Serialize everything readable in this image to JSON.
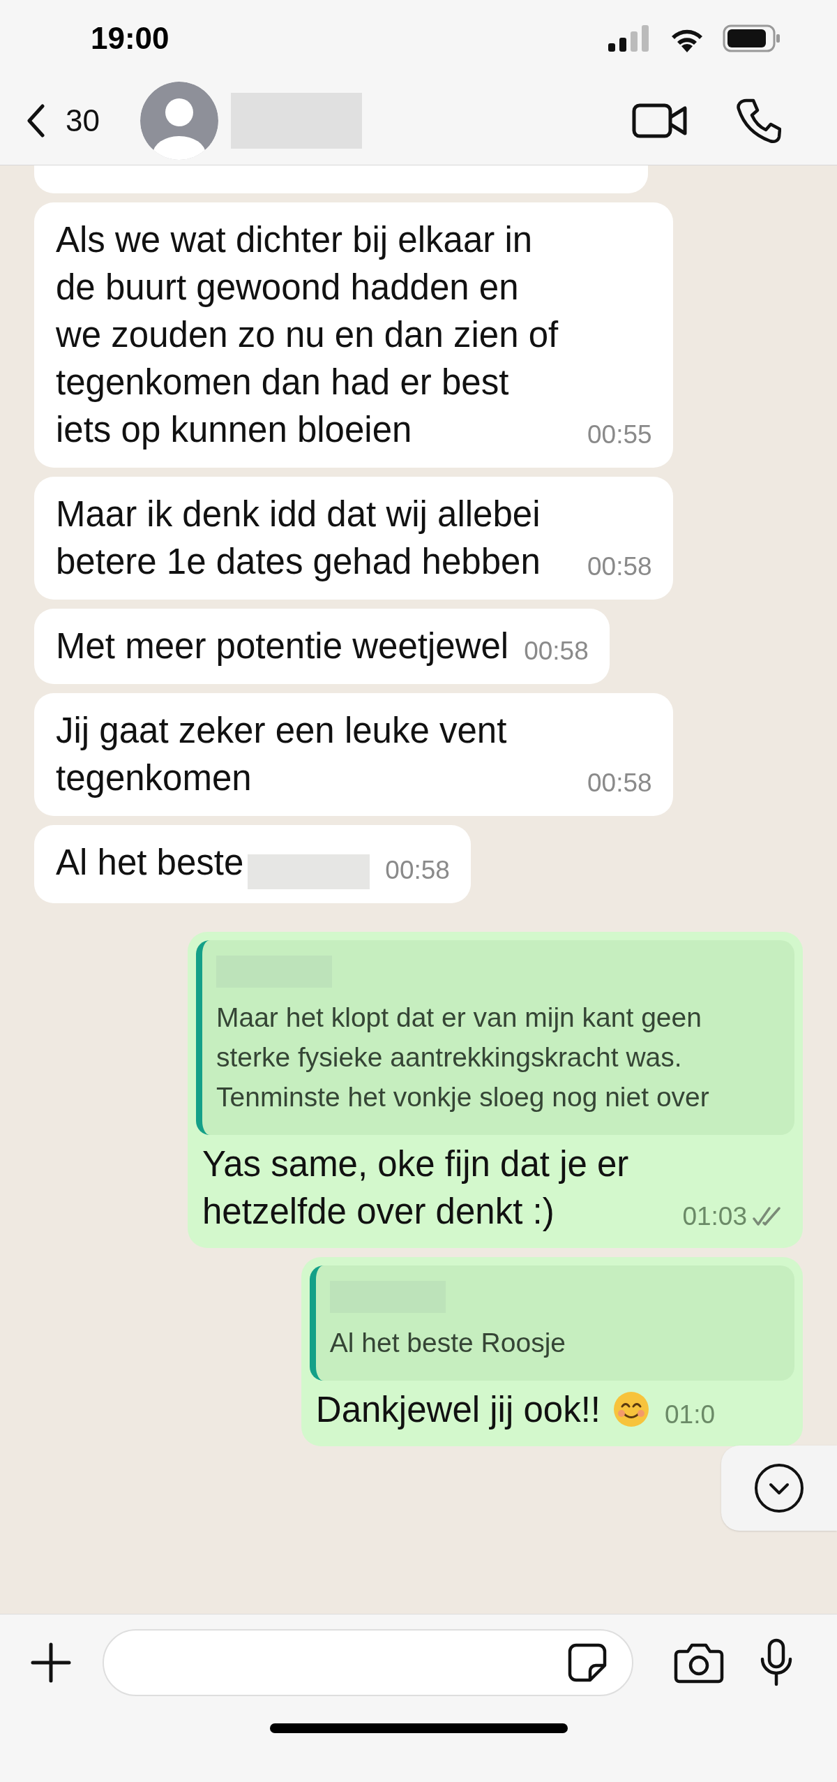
{
  "status_bar": {
    "time": "19:00"
  },
  "header": {
    "back_count": "30"
  },
  "messages": [
    {
      "outgoing": false,
      "text": "Als we wat dichter bij elkaar in de buurt gewoond hadden en we zouden zo nu en dan zien of tegenkomen dan had er best iets op kunnen bloeien",
      "time": "00:55"
    },
    {
      "outgoing": false,
      "text": "Maar ik denk idd dat wij allebei betere 1e dates gehad hebben",
      "time": "00:58"
    },
    {
      "outgoing": false,
      "text": "Met meer potentie weetjewel",
      "time": "00:58"
    },
    {
      "outgoing": false,
      "text": "Jij gaat zeker een leuke vent tegenkomen",
      "time": "00:58"
    },
    {
      "outgoing": false,
      "text": "Al het beste",
      "redacted_tail": true,
      "time": "00:58"
    },
    {
      "outgoing": true,
      "quote": {
        "text": "Maar het klopt dat er van mijn kant geen sterke fysieke aantrekkingskracht was. Tenminste het vonkje sloeg nog niet over"
      },
      "text": "Yas same, oke fijn dat je er hetzelfde over denkt :)",
      "time": "01:03",
      "ticks": true,
      "read": false
    },
    {
      "outgoing": true,
      "quote": {
        "text": "Al het beste Roosje"
      },
      "text": "Dankjewel jij ook!!",
      "smile_emoji": true,
      "time": "01:0"
    }
  ]
}
